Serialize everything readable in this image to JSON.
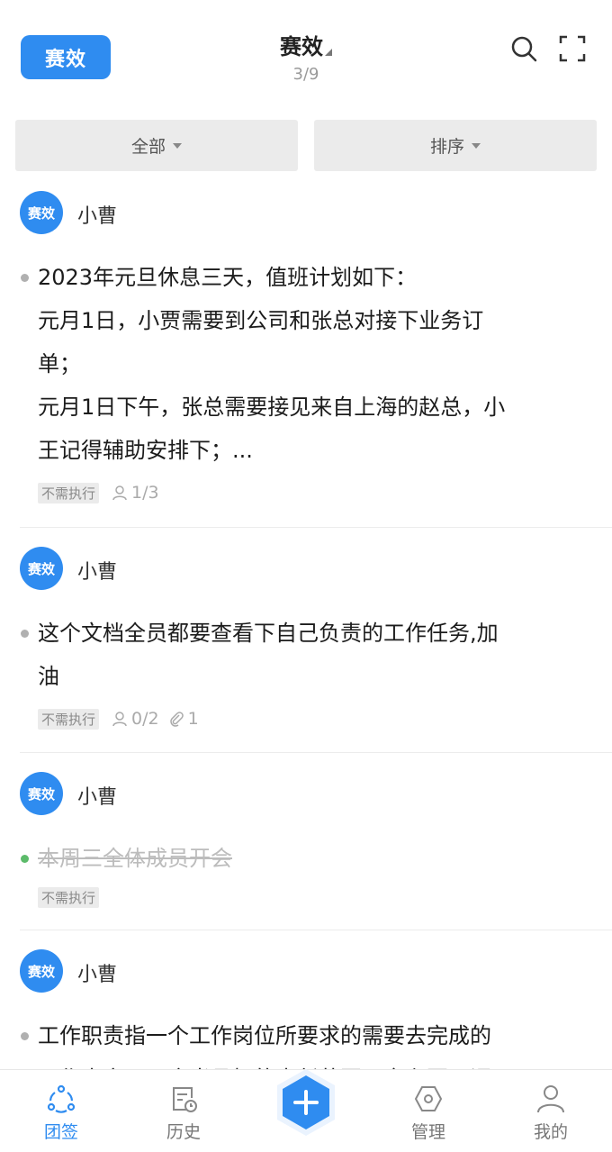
{
  "header": {
    "logo_text": "赛效",
    "title": "赛效",
    "counter": "3/9",
    "search_icon": "search-icon",
    "fullscreen_icon": "fullscreen-icon"
  },
  "filters": {
    "left_label": "全部",
    "right_label": "排序"
  },
  "cards": [
    {
      "avatar_text": "赛效",
      "author": "小曹",
      "lines": [
        "2023年元旦休息三天，值班计划如下：",
        "元月1日，小贾需要到公司和张总对接下业务订",
        "单；",
        "元月1日下午，张总需要接见来自上海的赵总，小",
        "王记得辅助安排下；..."
      ],
      "tag": "不需执行",
      "members": "1/3"
    },
    {
      "avatar_text": "赛效",
      "author": "小曹",
      "lines": [
        "这个文档全员都要查看下自己负责的工作任务,加",
        "油"
      ],
      "tag": "不需执行",
      "members": "0/2",
      "attachments": "1"
    },
    {
      "avatar_text": "赛效",
      "author": "小曹",
      "lines": [
        "本周三全体成员开会"
      ],
      "tag": "不需执行",
      "completed": true
    },
    {
      "avatar_text": "赛效",
      "author": "小曹",
      "lines": [
        "工作职责指一个工作岗位所要求的需要去完成的",
        "工作内容以及应当承担的责任范围，它主要强调"
      ]
    }
  ],
  "tabbar": {
    "items": [
      {
        "label": "团签",
        "icon": "team-sign-icon",
        "active": true
      },
      {
        "label": "历史",
        "icon": "history-icon"
      },
      {
        "label": "",
        "icon": "add-icon"
      },
      {
        "label": "管理",
        "icon": "manage-icon"
      },
      {
        "label": "我的",
        "icon": "profile-icon"
      }
    ]
  },
  "colors": {
    "accent": "#2f8cf0",
    "done_bullet": "#5cbb6a"
  }
}
